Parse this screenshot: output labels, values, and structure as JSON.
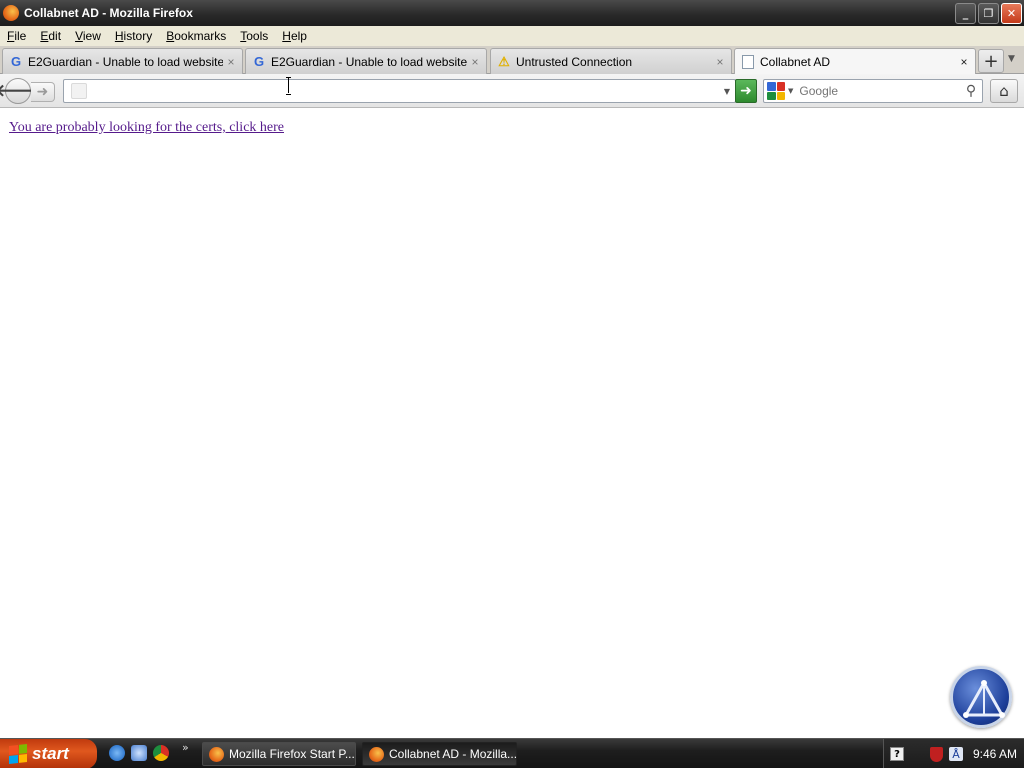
{
  "window": {
    "title": "Collabnet AD - Mozilla Firefox",
    "minimize_glyph": "_",
    "restore_glyph": "❐",
    "close_glyph": "✕"
  },
  "menubar": {
    "items": [
      {
        "label": "File",
        "accel": "F",
        "rest": "ile"
      },
      {
        "label": "Edit",
        "accel": "E",
        "rest": "dit"
      },
      {
        "label": "View",
        "accel": "V",
        "rest": "iew"
      },
      {
        "label": "History",
        "accel": "H",
        "rest": "istory"
      },
      {
        "label": "Bookmarks",
        "accel": "B",
        "rest": "ookmarks"
      },
      {
        "label": "Tools",
        "accel": "T",
        "rest": "ools"
      },
      {
        "label": "Help",
        "accel": "H",
        "rest": "elp"
      }
    ]
  },
  "tabs": [
    {
      "label": "E2Guardian - Unable to load website",
      "icon": "google-favicon-icon",
      "icon_glyph": "G",
      "active": false
    },
    {
      "label": "E2Guardian - Unable to load website",
      "icon": "google-favicon-icon",
      "icon_glyph": "G",
      "active": false
    },
    {
      "label": "Untrusted Connection",
      "icon": "warning-icon",
      "icon_glyph": "⚠",
      "active": false
    },
    {
      "label": "Collabnet AD",
      "icon": "blank-page-icon",
      "icon_glyph": "",
      "active": true
    }
  ],
  "tab_close_glyph": "×",
  "newtab_glyph": "+",
  "navbar": {
    "back_glyph": "🡐",
    "forward_glyph": "➜",
    "url_value": "",
    "go_glyph": "➜",
    "search_placeholder": "Google",
    "search_glyph": "⚲",
    "home_glyph": "⌂"
  },
  "content": {
    "link_text": "You are probably looking for the certs, click here"
  },
  "taskbar": {
    "start_label": "start",
    "quicklaunch_more": "»",
    "tasks": [
      {
        "label": "Mozilla Firefox Start P...",
        "active": false
      },
      {
        "label": "Collabnet AD - Mozilla...",
        "active": true
      }
    ],
    "tray_help": "?",
    "tray_net": "Å",
    "clock": "9:46 AM"
  },
  "colors": {
    "visited_link": "#551a8b",
    "go_button": "#3a9a3a",
    "start_button": "#d24a14",
    "google_blue": "#3367d6",
    "google_red": "#d93025",
    "google_yellow": "#f2b600",
    "google_green": "#1e8e3e"
  }
}
